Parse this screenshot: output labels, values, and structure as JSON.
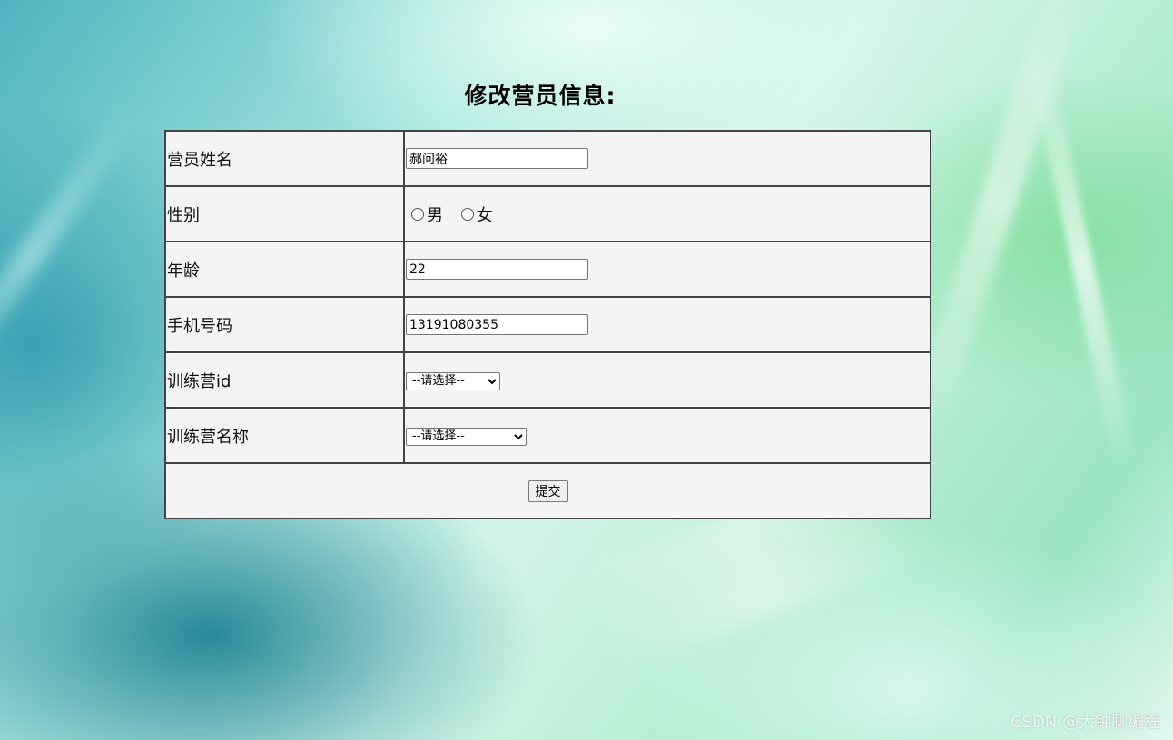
{
  "page_title": "修改营员信息:",
  "form": {
    "rows": [
      {
        "label": "营员姓名",
        "value": "郝问裕"
      },
      {
        "label": "性别",
        "options": [
          "男",
          "女"
        ]
      },
      {
        "label": "年龄",
        "value": "22"
      },
      {
        "label": "手机号码",
        "value": "13191080355"
      },
      {
        "label": "训练营id",
        "selected": "--请选择--"
      },
      {
        "label": "训练营名称",
        "selected": "--请选择--"
      }
    ],
    "submit_label": "提交"
  },
  "watermark": "CSDN @大钟聊编程"
}
